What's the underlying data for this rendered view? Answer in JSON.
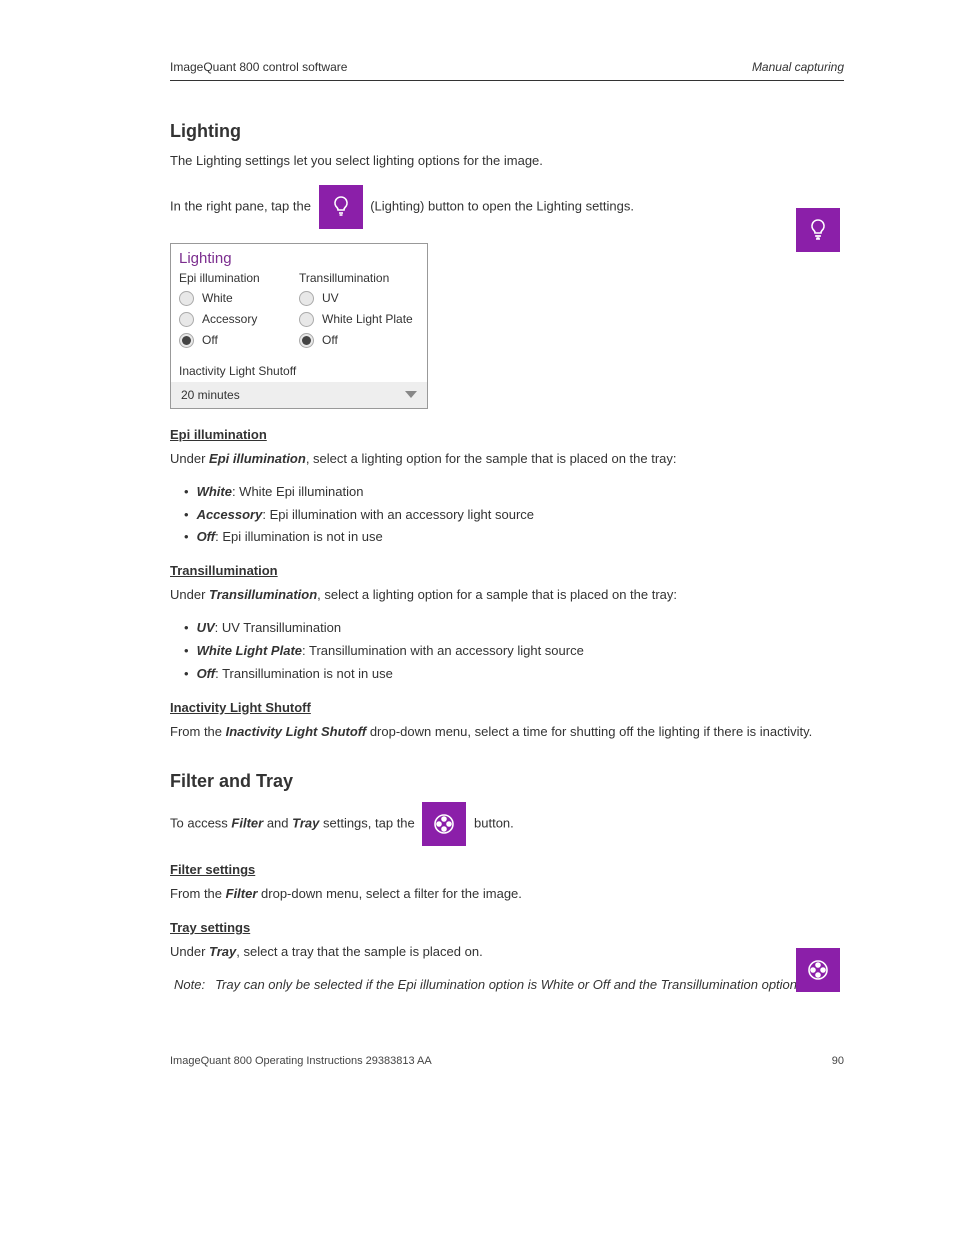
{
  "header": {
    "left": "ImageQuant 800 control software",
    "right": "Manual capturing"
  },
  "lighting_section": {
    "title": "Lighting",
    "intro": "The Lighting settings let you select lighting options for the image.",
    "instruction_prefix": "In the right pane, tap the ",
    "instruction_suffix": " (Lighting) button to open the Lighting settings.",
    "panel": {
      "title": "Lighting",
      "epi": {
        "label": "Epi illumination",
        "options": [
          "White",
          "Accessory",
          "Off"
        ],
        "selected": "Off"
      },
      "trans": {
        "label": "Transillumination",
        "options": [
          "UV",
          "White Light Plate",
          "Off"
        ],
        "selected": "Off"
      },
      "shutoff_label": "Inactivity Light Shutoff",
      "shutoff_value": "20 minutes"
    },
    "epi_desc": {
      "head": "Epi illumination",
      "body_prefix": "Under ",
      "body_bold": "Epi illumination",
      "body_suffix": ", select a lighting option for the sample that is placed on the tray:",
      "bullets": [
        {
          "bold": "White",
          "rest": ": White Epi illumination"
        },
        {
          "bold": "Accessory",
          "rest": ": Epi illumination with an accessory light source"
        },
        {
          "bold": "Off",
          "rest": ": Epi illumination is not in use"
        }
      ]
    },
    "trans_desc": {
      "head": "Transillumination",
      "body_prefix": "Under ",
      "body_bold": "Transillumination",
      "body_suffix": ", select a lighting option for a sample that is placed on the tray:",
      "bullets": [
        {
          "bold": "UV",
          "rest": ": UV Transillumination"
        },
        {
          "bold": "White Light Plate",
          "rest": ": Transillumination with an accessory light source"
        },
        {
          "bold": "Off",
          "rest": ": Transillumination is not in use"
        }
      ]
    },
    "shutoff_desc": {
      "head": "Inactivity Light Shutoff",
      "body_prefix": "From the ",
      "body_bold": "Inactivity Light Shutoff",
      "body_suffix": " drop-down menu, select a time for shutting off the lighting if there is inactivity."
    }
  },
  "filter_section": {
    "title": "Filter and Tray",
    "intro_prefix": "To access ",
    "intro_bold1": "Filter",
    "intro_mid": " and ",
    "intro_bold2": "Tray",
    "intro_mid2": " settings, tap the ",
    "intro_suffix": " button.",
    "filter_desc": {
      "head": "Filter settings",
      "body_prefix": "From the ",
      "body_bold": "Filter",
      "body_suffix": " drop-down menu, select a filter for the image."
    },
    "tray_desc": {
      "head": "Tray settings",
      "body_prefix": "Under ",
      "body_bold": "Tray",
      "body_suffix": ", select a tray that the sample is placed on.",
      "note_label": "Note:",
      "note_body": "Tray can only be selected if the Epi illumination option is White or Off and the Transillumination option is Off."
    }
  },
  "footer": {
    "left": "ImageQuant 800 Operating Instructions 29383813 AA",
    "right": "90"
  }
}
